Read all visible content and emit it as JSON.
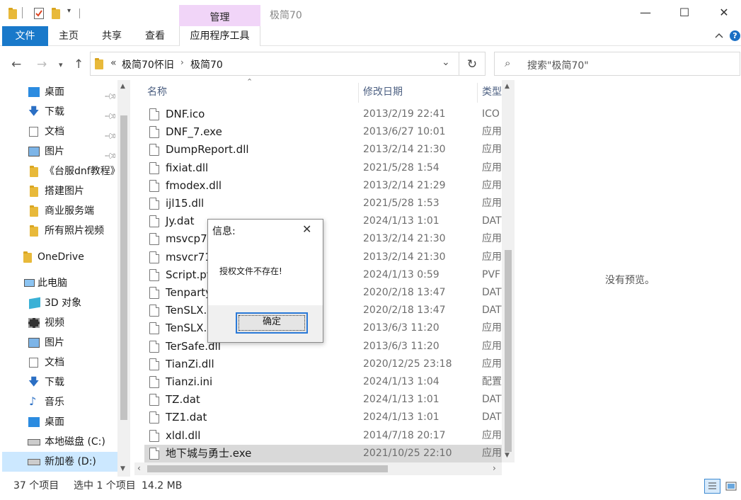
{
  "window": {
    "title": "极简70",
    "context_tab": "管理"
  },
  "ribbon": {
    "tabs": [
      "文件",
      "主页",
      "共享",
      "查看",
      "应用程序工具"
    ]
  },
  "address": {
    "overflow": "«",
    "path": [
      "极简70怀旧",
      "极简70"
    ]
  },
  "search": {
    "placeholder": "搜索\"极简70\""
  },
  "nav": {
    "quick": [
      {
        "label": "桌面",
        "icon": "desktop-icon",
        "pinned": true
      },
      {
        "label": "下载",
        "icon": "download-icon",
        "pinned": true
      },
      {
        "label": "文档",
        "icon": "document-icon",
        "pinned": true
      },
      {
        "label": "图片",
        "icon": "picture-icon",
        "pinned": true
      },
      {
        "label": "《台服dnf教程》",
        "icon": "folder-icon"
      },
      {
        "label": "搭建图片",
        "icon": "folder-icon"
      },
      {
        "label": "商业服务端",
        "icon": "folder-icon"
      },
      {
        "label": "所有照片视频",
        "icon": "folder-icon"
      }
    ],
    "onedrive": "OneDrive",
    "thispc": "此电脑",
    "pc_items": [
      {
        "label": "3D 对象",
        "icon": "3d-objects-icon"
      },
      {
        "label": "视频",
        "icon": "video-icon"
      },
      {
        "label": "图片",
        "icon": "picture-icon"
      },
      {
        "label": "文档",
        "icon": "document-icon"
      },
      {
        "label": "下载",
        "icon": "download-icon"
      },
      {
        "label": "音乐",
        "icon": "music-icon"
      },
      {
        "label": "桌面",
        "icon": "desktop-icon"
      },
      {
        "label": "本地磁盘 (C:)",
        "icon": "drive-icon"
      },
      {
        "label": "新加卷 (D:)",
        "icon": "drive-icon"
      }
    ]
  },
  "columns": {
    "name": "名称",
    "date": "修改日期",
    "type": "类型"
  },
  "files": [
    {
      "name": "DNF.ico",
      "date": "2013/2/19 22:41",
      "type": "ICO"
    },
    {
      "name": "DNF_7.exe",
      "date": "2013/6/27 10:01",
      "type": "应用"
    },
    {
      "name": "DumpReport.dll",
      "date": "2013/2/14 21:30",
      "type": "应用"
    },
    {
      "name": "fixiat.dll",
      "date": "2021/5/28 1:54",
      "type": "应用"
    },
    {
      "name": "fmodex.dll",
      "date": "2013/2/14 21:29",
      "type": "应用"
    },
    {
      "name": "ijl15.dll",
      "date": "2021/5/28 1:53",
      "type": "应用"
    },
    {
      "name": "Jy.dat",
      "date": "2024/1/13 1:01",
      "type": "DAT"
    },
    {
      "name": "msvcp71",
      "date": "2013/2/14 21:30",
      "type": "应用"
    },
    {
      "name": "msvcr71.",
      "date": "2013/2/14 21:30",
      "type": "应用"
    },
    {
      "name": "Script.pv",
      "date": "2024/1/13 0:59",
      "type": "PVF"
    },
    {
      "name": "Tenparty",
      "date": "2020/2/18 13:47",
      "type": "DAT"
    },
    {
      "name": "TenSLX.c",
      "date": "2020/2/18 13:47",
      "type": "DAT"
    },
    {
      "name": "TenSLX.c",
      "date": "2013/6/3 11:20",
      "type": "应用"
    },
    {
      "name": "TerSafe.dll",
      "date": "2013/6/3 11:20",
      "type": "应用"
    },
    {
      "name": "TianZi.dll",
      "date": "2020/12/25 23:18",
      "type": "应用"
    },
    {
      "name": "Tianzi.ini",
      "date": "2024/1/13 1:04",
      "type": "配置"
    },
    {
      "name": "TZ.dat",
      "date": "2024/1/13 1:01",
      "type": "DAT"
    },
    {
      "name": "TZ1.dat",
      "date": "2024/1/13 1:01",
      "type": "DAT"
    },
    {
      "name": "xldl.dll",
      "date": "2014/7/18 20:17",
      "type": "应用"
    },
    {
      "name": "地下城与勇士.exe",
      "date": "2021/10/25 22:10",
      "type": "应用"
    }
  ],
  "preview": {
    "empty_text": "没有预览。"
  },
  "status": {
    "count": "37 个项目",
    "selection": "选中 1 个项目",
    "size": "14.2 MB"
  },
  "dialog": {
    "title": "信息:",
    "message": "授权文件不存在!",
    "ok": "确定"
  }
}
